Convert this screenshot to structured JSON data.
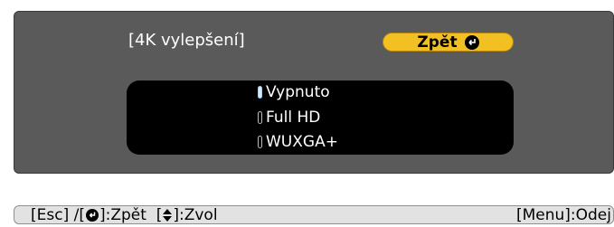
{
  "menu": {
    "title": "[4K vylepšení]",
    "back_button": "Zpět",
    "options": [
      {
        "label": "Vypnuto",
        "selected": true
      },
      {
        "label": "Full HD",
        "selected": false
      },
      {
        "label": "WUXGA+",
        "selected": false
      }
    ]
  },
  "help_bar": {
    "esc_part": "[Esc] /[",
    "back_part": "]:Zpět  [",
    "select_part": "]:Zvol",
    "menu_part": "[Menu]:Odej"
  },
  "colors": {
    "panel": "#5a5a5a",
    "button": "#f2c023",
    "options_bg": "#000000",
    "help_bar": "#e2e2e2"
  },
  "icons": {
    "enter": "enter-icon",
    "up_down": "up-down-arrows-icon"
  }
}
